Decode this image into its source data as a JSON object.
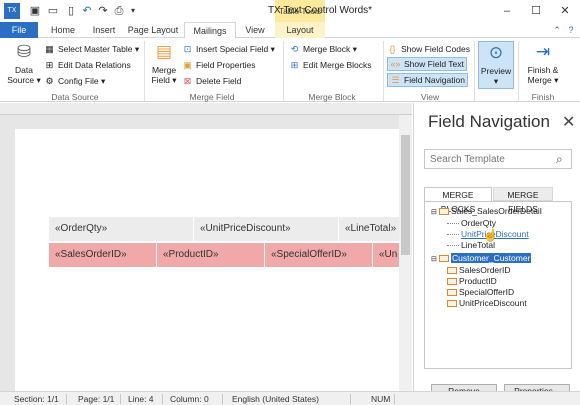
{
  "window": {
    "title": "TX Text Control Words*",
    "table_tools": "Table Tools",
    "minimize": "–",
    "maximize": "☐",
    "close": "✕"
  },
  "tabs": [
    {
      "label": "File"
    },
    {
      "label": "Home"
    },
    {
      "label": "Insert"
    },
    {
      "label": "Page Layout"
    },
    {
      "label": "Mailings"
    },
    {
      "label": "View"
    },
    {
      "label": "Layout"
    }
  ],
  "ribbon": {
    "data_source": {
      "big_label": "Data\nSource ▾",
      "select_master_table": "Select Master Table ▾",
      "edit_data_relations": "Edit Data Relations",
      "config_file": "Config File ▾",
      "group": "Data Source"
    },
    "merge_field": {
      "big_label": "Merge\nField ▾",
      "insert_special_field": "Insert Special Field ▾",
      "field_properties": "Field Properties",
      "delete_field": "Delete Field",
      "group": "Merge Field"
    },
    "merge_block": {
      "merge_block": "Merge Block ▾",
      "edit_merge_blocks": "Edit Merge Blocks",
      "group": "Merge Block"
    },
    "view": {
      "show_field_codes": "Show Field Codes",
      "show_field_text": "Show Field Text",
      "field_navigation": "Field Navigation",
      "group": "View"
    },
    "preview": {
      "label": "Preview\n▾"
    },
    "finish": {
      "label": "Finish &\nMerge ▾",
      "group": "Finish"
    }
  },
  "document": {
    "row1": [
      "«OrderQty»",
      "«UnitPriceDiscount»",
      "«LineTotal»"
    ],
    "row2": [
      "«SalesOrderID»",
      "«ProductID»",
      "«SpecialOfferID»",
      "«Un"
    ]
  },
  "panel": {
    "title": "Field Navigation",
    "close": "✕",
    "search_placeholder": "Search Template",
    "tab_blocks": "MERGE BLOCKS",
    "tab_fields": "MERGE FIELDS",
    "tree": {
      "block1": "Sales_SalesOrderDetail",
      "block1_fields": [
        "OrderQty",
        "UnitPriceDiscount",
        "LineTotal"
      ],
      "block2": "Customer_Customer",
      "block2_fields": [
        "SalesOrderID",
        "ProductID",
        "SpecialOfferID",
        "UnitPriceDiscount"
      ]
    },
    "remove": "Remove",
    "properties": "Properties..."
  },
  "status": {
    "section": "Section: 1/1",
    "page": "Page: 1/1",
    "line": "Line: 4",
    "column": "Column: 0",
    "language": "English (United States)",
    "num": "NUM"
  }
}
